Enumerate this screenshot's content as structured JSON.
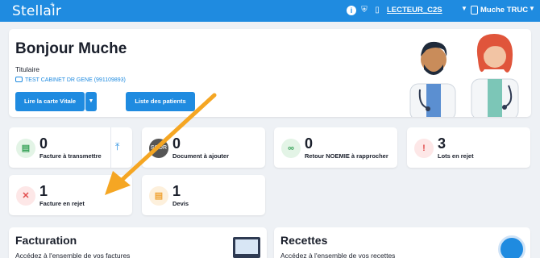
{
  "topbar": {
    "logo": "Stellair",
    "reader": "LECTEUR_C2S",
    "user": "Muche TRUC",
    "accent": "#1f8be0"
  },
  "hero": {
    "greeting": "Bonjour Muche",
    "role": "Titulaire",
    "cabinet": "TEST CABINET DR GENE (991109893)",
    "btn_vitale": "Lire la carte Vitale",
    "btn_patients": "Liste des patients"
  },
  "stats": [
    {
      "value": "0",
      "label": "Facture à transmettre",
      "icon": "file-icon"
    },
    {
      "value": "0",
      "label": "Document à ajouter",
      "icon": "scor-icon",
      "badge": "SCOR"
    },
    {
      "value": "0",
      "label": "Retour NOEMIE à rapprocher",
      "icon": "link-icon"
    },
    {
      "value": "3",
      "label": "Lots en rejet",
      "icon": "alert-icon"
    },
    {
      "value": "1",
      "label": "Facture en rejet",
      "icon": "close-circle-icon"
    },
    {
      "value": "1",
      "label": "Devis",
      "icon": "document-icon"
    }
  ],
  "sections": [
    {
      "title": "Facturation",
      "subtitle": "Accédez à l'ensemble de vos factures"
    },
    {
      "title": "Recettes",
      "subtitle": "Accédez à l'ensemble de vos recettes"
    }
  ]
}
